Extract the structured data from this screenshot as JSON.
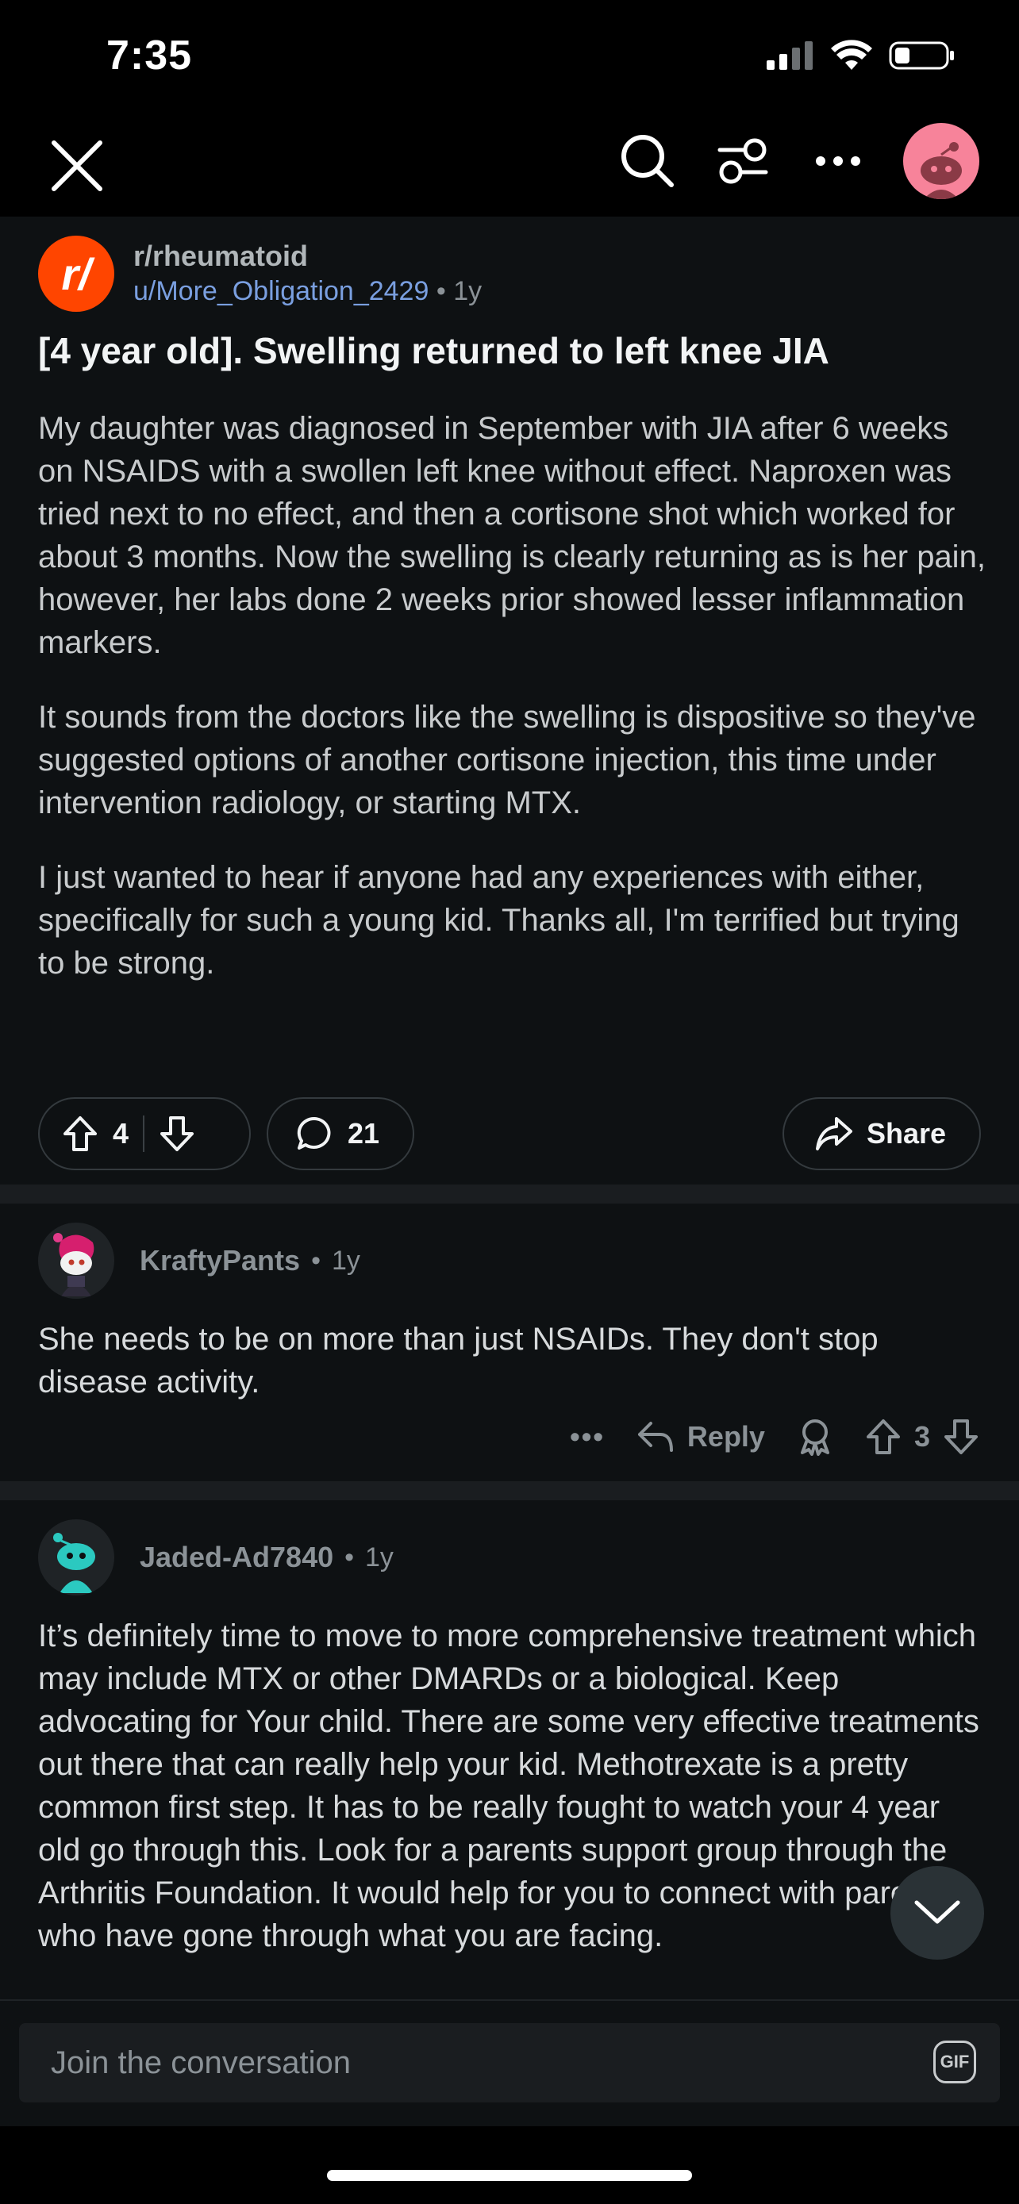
{
  "status_bar": {
    "time": "7:35"
  },
  "nav": {
    "close": "close-icon",
    "search": "search-icon",
    "filter": "sort-filter-icon",
    "more": "more-icon",
    "avatar": "user-avatar"
  },
  "post": {
    "subreddit": "r/rheumatoid",
    "subreddit_icon_text": "r/",
    "author": "u/More_Obligation_2429",
    "separator": "•",
    "age": "1y",
    "title": "[4 year old]. Swelling returned to left knee JIA",
    "body": [
      "My daughter was diagnosed in September with JIA after 6 weeks on NSAIDS with a swollen left knee without effect.  Naproxen was tried next to no effect, and then a cortisone shot which worked for about 3 months.  Now the swelling is clearly returning as is her pain, however, her labs done 2 weeks prior showed lesser inflammation markers.",
      "It sounds from the doctors like the swelling is dispositive so they've suggested options of another cortisone injection, this time under intervention radiology, or starting MTX.",
      "I just wanted to hear if anyone had any experiences with either, specifically for such a young kid.  Thanks all, I'm terrified but trying to be strong."
    ],
    "votes": "4",
    "comments": "21",
    "share_label": "Share"
  },
  "comments": [
    {
      "user": "KraftyPants",
      "separator": "•",
      "age": "1y",
      "body": "She needs to be on more than just NSAIDs. They don't stop disease activity.",
      "more": "•••",
      "reply_label": "Reply",
      "votes": "3"
    },
    {
      "user": "Jaded-Ad7840",
      "separator": "•",
      "age": "1y",
      "body": "It’s definitely time to move to more comprehensive treatment which may include MTX or other DMARDs or a biological.  Keep advocating for Your child.  There are some very effective treatments out there that can really help your kid.  Methotrexate is a pretty common first step.  It has to be really fought to watch your 4 year old go through this.  Look for a parents support group through the Arthritis Foundation.  It would help for you to connect with parents who have gone through what you are facing."
    }
  ],
  "compose": {
    "placeholder": "Join the conversation",
    "gif_label": "GIF"
  },
  "colors": {
    "background": "#0e1113",
    "subreddit_icon": "#ff4500",
    "author_link": "#7a9fe0",
    "avatar_pink": "#f7839a"
  }
}
